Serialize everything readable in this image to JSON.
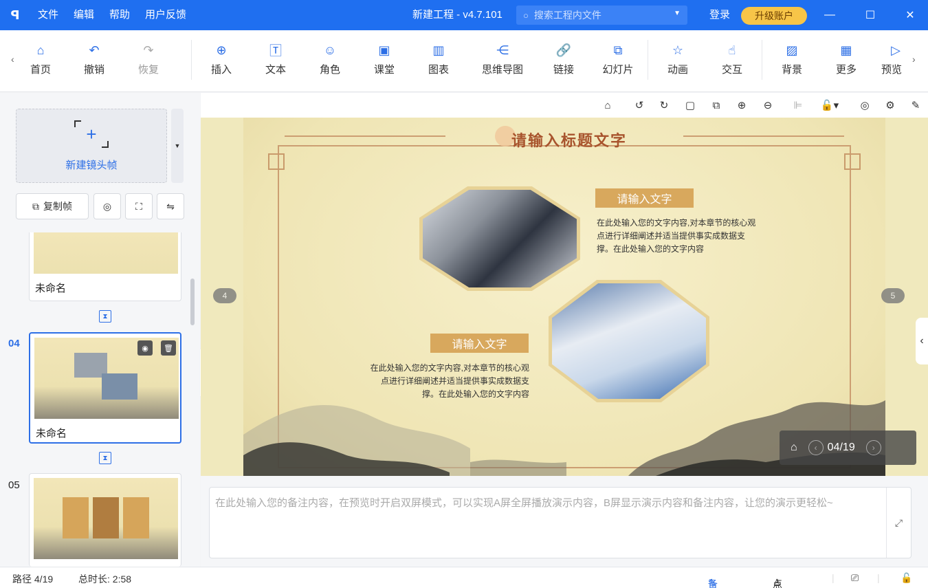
{
  "titlebar": {
    "menu": [
      "文件",
      "编辑",
      "帮助",
      "用户反馈"
    ],
    "title": "新建工程 - v4.7.101",
    "search_placeholder": "搜索工程内文件",
    "login": "登录",
    "upgrade": "升级账户",
    "accent": "#1f6ff0"
  },
  "toolbar": {
    "history": [
      {
        "label": "首页",
        "icon": "home-icon"
      },
      {
        "label": "撤销",
        "icon": "undo-icon"
      },
      {
        "label": "恢复",
        "icon": "redo-icon"
      }
    ],
    "insert": [
      {
        "label": "插入",
        "icon": "plus-circle-icon"
      },
      {
        "label": "文本",
        "icon": "text-icon"
      },
      {
        "label": "角色",
        "icon": "person-icon"
      },
      {
        "label": "课堂",
        "icon": "classroom-icon"
      },
      {
        "label": "图表",
        "icon": "bar-chart-icon"
      },
      {
        "label": "思维导图",
        "icon": "mindmap-icon"
      },
      {
        "label": "链接",
        "icon": "link-icon"
      },
      {
        "label": "幻灯片",
        "icon": "slides-icon"
      }
    ],
    "anim": [
      {
        "label": "动画",
        "icon": "star-icon"
      },
      {
        "label": "交互",
        "icon": "hand-icon"
      }
    ],
    "more": [
      {
        "label": "背景",
        "icon": "background-icon"
      },
      {
        "label": "更多",
        "icon": "grid-icon"
      },
      {
        "label": "预览",
        "icon": "preview-icon"
      }
    ]
  },
  "left_panel": {
    "new_frame_label": "新建镜头帧",
    "copy_frame_label": "复制帧",
    "slides": [
      {
        "number": "",
        "name": "未命名",
        "selected": false
      },
      {
        "number": "04",
        "name": "未命名",
        "selected": true
      },
      {
        "number": "05",
        "name": "",
        "selected": false
      }
    ]
  },
  "slide": {
    "title": "请输入标题文字",
    "heading_1": "请输入文字",
    "body_1": "在此处输入您的文字内容,对本章节的核心观点进行详细阐述并适当提供事实成数据支撑。在此处输入您的文字内容",
    "heading_2": "请输入文字",
    "body_2": "在此处输入您的文字内容,对本章节的核心观点进行详细阐述并适当提供事实成数据支撑。在此处输入您的文字内容",
    "prev_badge": "4",
    "next_badge": "5",
    "page_indicator": "04/19"
  },
  "notes": {
    "placeholder": "在此处输入您的备注内容，在预览时开启双屏模式，可以实现A屏全屏播放演示内容，B屏显示演示内容和备注内容，让您的演示更轻松~"
  },
  "statusbar": {
    "path": "路径 4/19",
    "duration": "总时长: 2:58",
    "notes_label": "备注",
    "rollcall_label": "点名"
  }
}
